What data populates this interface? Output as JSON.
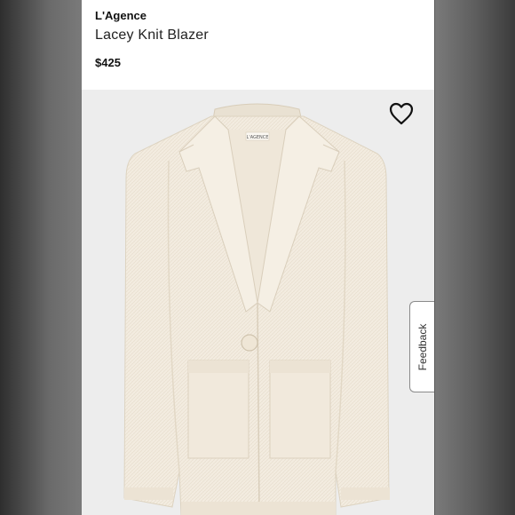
{
  "product": {
    "brand": "L'Agence",
    "name": "Lacey Knit Blazer",
    "price": "$425"
  },
  "image": {
    "alt": "Ivory knit blazer with single button and patch pockets",
    "label_text": "L'AGENCE"
  },
  "actions": {
    "favorite_icon": "heart-outline-icon",
    "feedback_label": "Feedback"
  },
  "colors": {
    "background": "#ededed",
    "garment": "#f3ece0",
    "text": "#111111"
  }
}
